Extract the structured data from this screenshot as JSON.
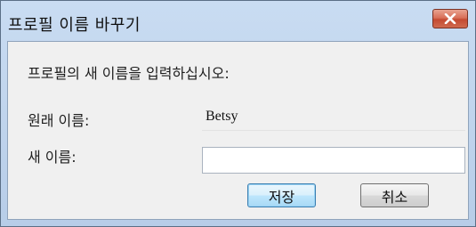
{
  "window": {
    "title": "프로필 이름 바꾸기"
  },
  "dialog": {
    "prompt": "프로필의 새 이름을 입력하십시오:",
    "original_name_label": "원래 이름:",
    "original_name_value": "Betsy",
    "new_name_label": "새 이름:",
    "new_name_value": "",
    "save_label": "저장",
    "cancel_label": "취소"
  },
  "icons": {
    "close": "close-icon"
  },
  "colors": {
    "close_button": "#c44a32",
    "title_bar": "#c9dcf2",
    "default_button_border": "#3c7fb1"
  }
}
